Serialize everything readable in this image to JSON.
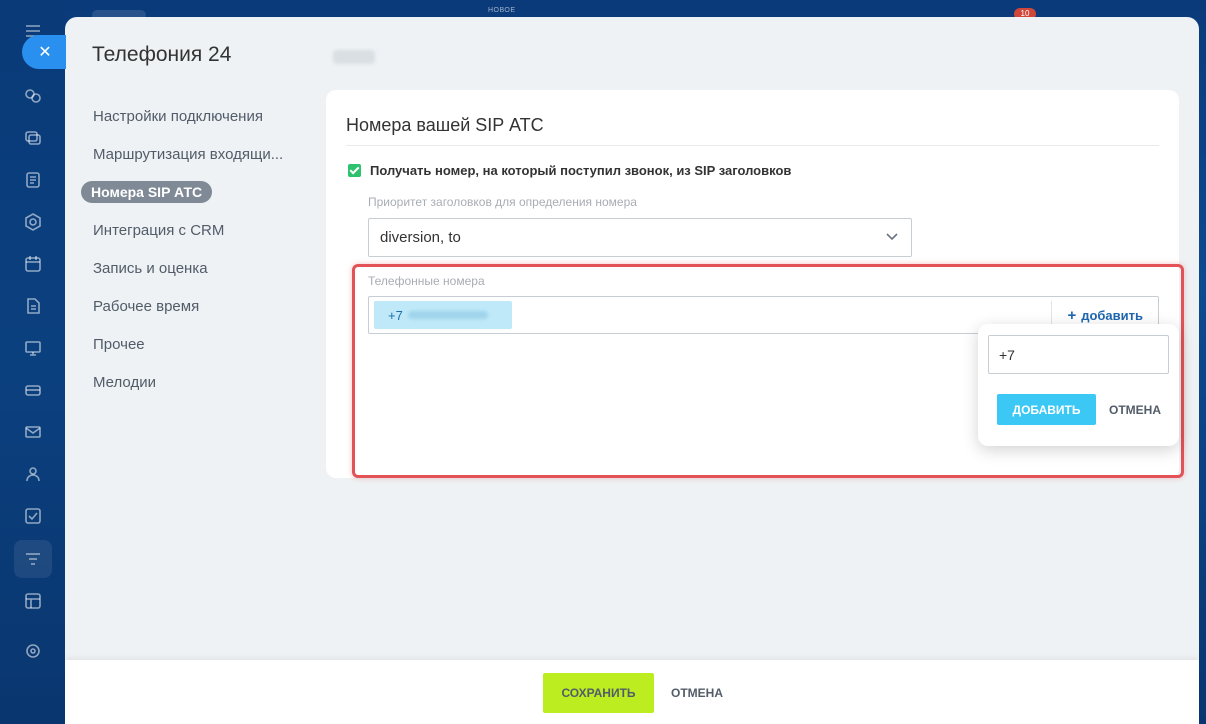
{
  "topbar": {
    "new_label": "НОВОЕ",
    "notification_count": "10"
  },
  "panel": {
    "title": "Телефония 24"
  },
  "nav": {
    "items": [
      {
        "label": "Настройки подключения"
      },
      {
        "label": "Маршрутизация входящи..."
      },
      {
        "label": "Номера SIP АТС",
        "active": true
      },
      {
        "label": "Интеграция с CRM"
      },
      {
        "label": "Запись и оценка"
      },
      {
        "label": "Рабочее время"
      },
      {
        "label": "Прочее"
      },
      {
        "label": "Мелодии"
      }
    ]
  },
  "card": {
    "title": "Номера вашей SIP АТС",
    "checkbox_label": "Получать номер, на который поступил звонок, из SIP заголовков",
    "checkbox_checked": true,
    "priority_label": "Приоритет заголовков для определения номера",
    "priority_value": "diversion, to",
    "phones_label": "Телефонные номера",
    "phone_chip": "+7",
    "add_link": "добавить"
  },
  "popup": {
    "input_value": "+7",
    "add_button": "ДОБАВИТЬ",
    "cancel_button": "ОТМЕНА"
  },
  "footer": {
    "save_button": "СОХРАНИТЬ",
    "cancel_button": "ОТМЕНА"
  },
  "colors": {
    "accent_blue": "#3bc8f5",
    "save_green": "#bbed21",
    "highlight_red": "#e25256",
    "checkbox_green": "#2fc26e"
  }
}
